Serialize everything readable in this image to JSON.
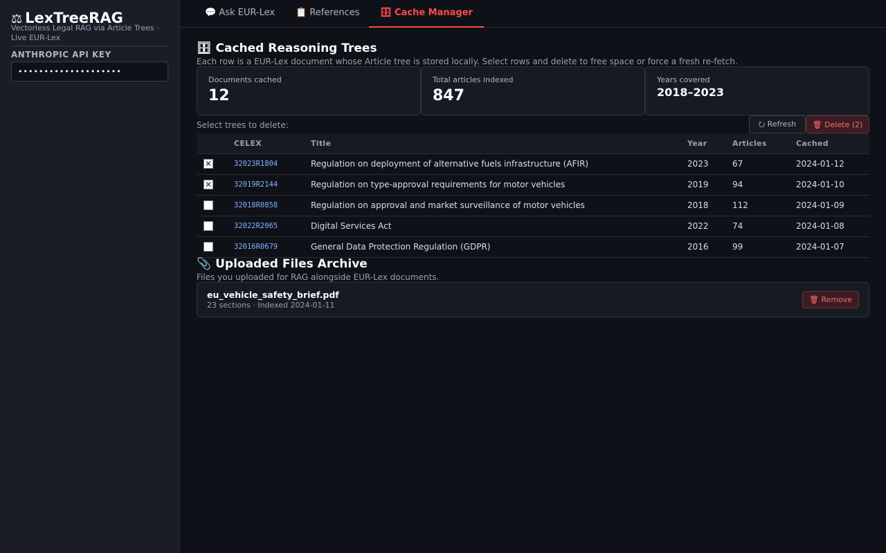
{
  "sidebar": {
    "brand_icon": "⚖",
    "brand": "LexTreeRAG",
    "subtitle": "Vectorless Legal RAG via Article Trees · Live EUR-Lex",
    "api_label": "ANTHROPIC API KEY",
    "api_value": "••••••••••••••••••••"
  },
  "tabs": [
    {
      "icon": "💬",
      "label": "Ask EUR-Lex",
      "active": false
    },
    {
      "icon": "📋",
      "label": "References",
      "active": false
    },
    {
      "icon": "🗄",
      "label": "Cache Manager",
      "active": true
    }
  ],
  "cache": {
    "icon": "🗄",
    "title": "Cached Reasoning Trees",
    "caption": "Each row is a EUR-Lex document whose Article tree is stored locally. Select rows and delete to free space or force a fresh re-fetch.",
    "metrics": [
      {
        "label": "Documents cached",
        "value": "12"
      },
      {
        "label": "Total articles indexed",
        "value": "847"
      },
      {
        "label": "Years covered",
        "value": "2018–2023"
      }
    ],
    "select_label": "Select trees to delete:",
    "refresh_label": "⭮ Refresh",
    "delete_label": "🗑 Delete (2)",
    "columns": [
      "",
      "CELEX",
      "Title",
      "Year",
      "Articles",
      "Cached"
    ],
    "rows": [
      {
        "checked": true,
        "celex": "32023R1804",
        "title": "Regulation on deployment of alternative fuels infrastructure (AFIR)",
        "year": "2023",
        "articles": "67",
        "cached": "2024-01-12"
      },
      {
        "checked": true,
        "celex": "32019R2144",
        "title": "Regulation on type-approval requirements for motor vehicles",
        "year": "2019",
        "articles": "94",
        "cached": "2024-01-10"
      },
      {
        "checked": false,
        "celex": "32018R0858",
        "title": "Regulation on approval and market surveillance of motor vehicles",
        "year": "2018",
        "articles": "112",
        "cached": "2024-01-09"
      },
      {
        "checked": false,
        "celex": "32022R2065",
        "title": "Digital Services Act",
        "year": "2022",
        "articles": "74",
        "cached": "2024-01-08"
      },
      {
        "checked": false,
        "celex": "32016R0679",
        "title": "General Data Protection Regulation (GDPR)",
        "year": "2016",
        "articles": "99",
        "cached": "2024-01-07"
      }
    ]
  },
  "uploads": {
    "icon": "📎",
    "title": "Uploaded Files Archive",
    "caption": "Files you uploaded for RAG alongside EUR-Lex documents.",
    "files": [
      {
        "name": "eu_vehicle_safety_brief.pdf",
        "meta": "23 sections · Indexed 2024-01-11",
        "remove_label": "🗑 Remove"
      }
    ]
  },
  "colors": {
    "accent": "#ff4b4b",
    "link": "#7fb4ff",
    "bg": "#0e1117",
    "sidebar": "#1a1d26"
  }
}
